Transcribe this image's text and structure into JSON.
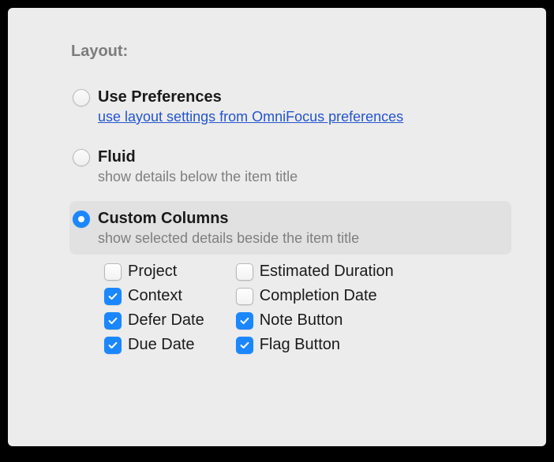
{
  "section_label": "Layout:",
  "options": {
    "use_prefs": {
      "title": "Use Preferences",
      "link": "use layout settings from OmniFocus preferences"
    },
    "fluid": {
      "title": "Fluid",
      "desc": "show details below the item title"
    },
    "custom": {
      "title": "Custom Columns",
      "desc": "show selected details beside the item title"
    }
  },
  "columns": {
    "left": [
      {
        "label": "Project",
        "checked": false
      },
      {
        "label": "Context",
        "checked": true
      },
      {
        "label": "Defer Date",
        "checked": true
      },
      {
        "label": "Due Date",
        "checked": true
      }
    ],
    "right": [
      {
        "label": "Estimated Duration",
        "checked": false
      },
      {
        "label": "Completion Date",
        "checked": false
      },
      {
        "label": "Note Button",
        "checked": true
      },
      {
        "label": "Flag Button",
        "checked": true
      }
    ]
  }
}
